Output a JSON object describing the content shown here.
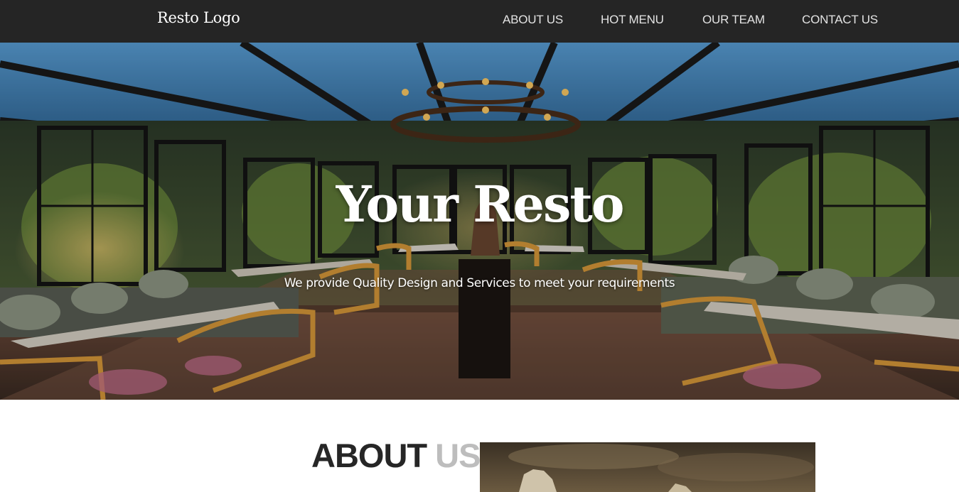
{
  "navbar": {
    "brand": "Resto Logo",
    "links": [
      {
        "label": "ABOUT US"
      },
      {
        "label": "HOT MENU"
      },
      {
        "label": "OUR TEAM"
      },
      {
        "label": "CONTACT US"
      }
    ]
  },
  "hero": {
    "title": "Your Resto",
    "tagline": "We provide Quality Design and Services to meet your requirements"
  },
  "about": {
    "heading_dark": "ABOUT",
    "heading_light": "US"
  },
  "colors": {
    "navbar_bg": "#252525",
    "nav_text": "#e3e3e3",
    "heading_dark": "#262626",
    "heading_light": "#bdbdbd"
  }
}
